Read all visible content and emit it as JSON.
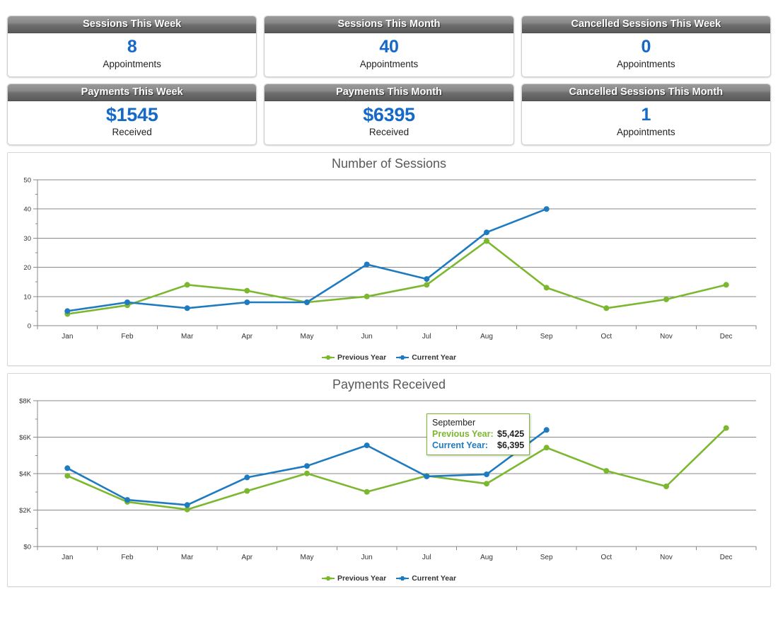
{
  "kpis": [
    {
      "title": "Sessions This Week",
      "value": "8",
      "label": "Appointments",
      "money": false
    },
    {
      "title": "Sessions This Month",
      "value": "40",
      "label": "Appointments",
      "money": false
    },
    {
      "title": "Cancelled Sessions This Week",
      "value": "0",
      "label": "Appointments",
      "money": false
    },
    {
      "title": "Payments This Week",
      "value": "$1545",
      "label": "Received",
      "money": true
    },
    {
      "title": "Payments This Month",
      "value": "$6395",
      "label": "Received",
      "money": true
    },
    {
      "title": "Cancelled Sessions This Month",
      "value": "1",
      "label": "Appointments",
      "money": false
    }
  ],
  "colors": {
    "previous_year": "#7cb82f",
    "current_year": "#1f7bbf",
    "value_blue": "#1569C7",
    "grid": "#808080",
    "axis_text": "#333333"
  },
  "legend": {
    "previous_label": "Previous Year",
    "current_label": "Current Year"
  },
  "tooltip": {
    "month": "September",
    "prev_key": "Previous Year:",
    "prev_value": "$5,425",
    "curr_key": "Current Year:",
    "curr_value": "$6,395"
  },
  "chart_data": [
    {
      "type": "line",
      "title": "Number of Sessions",
      "xlabel": "",
      "ylabel": "",
      "categories": [
        "Jan",
        "Feb",
        "Mar",
        "Apr",
        "May",
        "Jun",
        "Jul",
        "Aug",
        "Sep",
        "Oct",
        "Nov",
        "Dec"
      ],
      "ylim": [
        0,
        50
      ],
      "yticks": [
        0,
        10,
        20,
        30,
        40,
        50
      ],
      "ytick_labels": [
        "0",
        "10",
        "20",
        "30",
        "40",
        "50"
      ],
      "grid": true,
      "legend_position": "bottom",
      "series": [
        {
          "name": "Previous Year",
          "color": "#7cb82f",
          "values": [
            4,
            7,
            14,
            12,
            8,
            10,
            14,
            29,
            13,
            6,
            9,
            14
          ]
        },
        {
          "name": "Current Year",
          "color": "#1f7bbf",
          "values": [
            5,
            8,
            6,
            8,
            8,
            21,
            16,
            32,
            40,
            null,
            null,
            null
          ]
        }
      ]
    },
    {
      "type": "line",
      "title": "Payments Received",
      "xlabel": "",
      "ylabel": "",
      "categories": [
        "Jan",
        "Feb",
        "Mar",
        "Apr",
        "May",
        "Jun",
        "Jul",
        "Aug",
        "Sep",
        "Oct",
        "Nov",
        "Dec"
      ],
      "ylim": [
        0,
        8000
      ],
      "yticks": [
        0,
        2000,
        4000,
        6000,
        8000
      ],
      "ytick_labels": [
        "$0",
        "$2K",
        "$4K",
        "$6K",
        "$8K"
      ],
      "grid": true,
      "legend_position": "bottom",
      "series": [
        {
          "name": "Previous Year",
          "color": "#7cb82f",
          "values": [
            3880,
            2450,
            2030,
            3050,
            4010,
            3000,
            3880,
            3450,
            5425,
            4150,
            3300,
            6500
          ]
        },
        {
          "name": "Current Year",
          "color": "#1f7bbf",
          "values": [
            4300,
            2560,
            2280,
            3790,
            4420,
            5550,
            3850,
            3960,
            6395,
            null,
            null,
            null
          ]
        }
      ]
    }
  ]
}
